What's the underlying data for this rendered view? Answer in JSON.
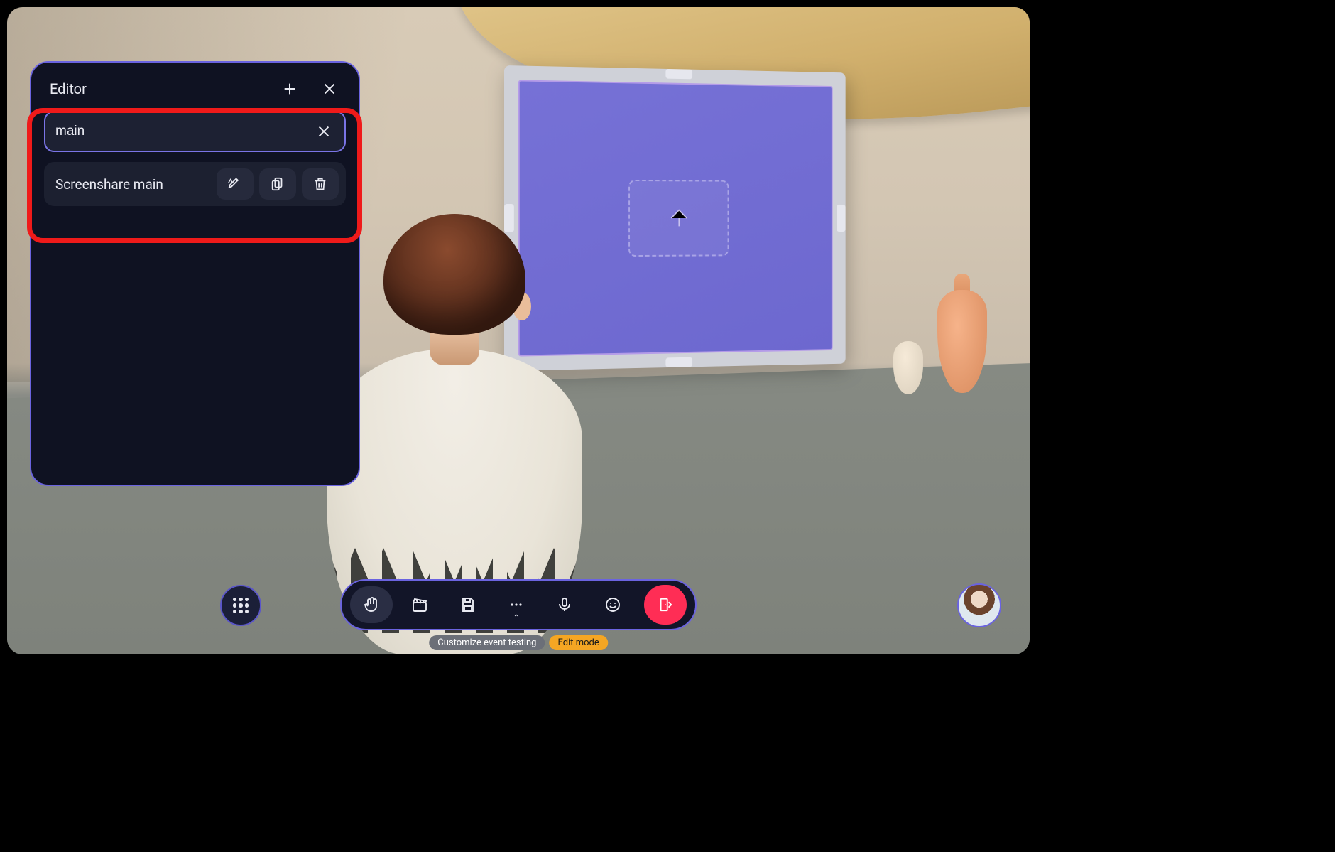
{
  "editor": {
    "title": "Editor",
    "search_value": "main",
    "item": {
      "label": "Screenshare main"
    }
  },
  "status": {
    "left": "Customize event testing",
    "right": "Edit mode"
  }
}
